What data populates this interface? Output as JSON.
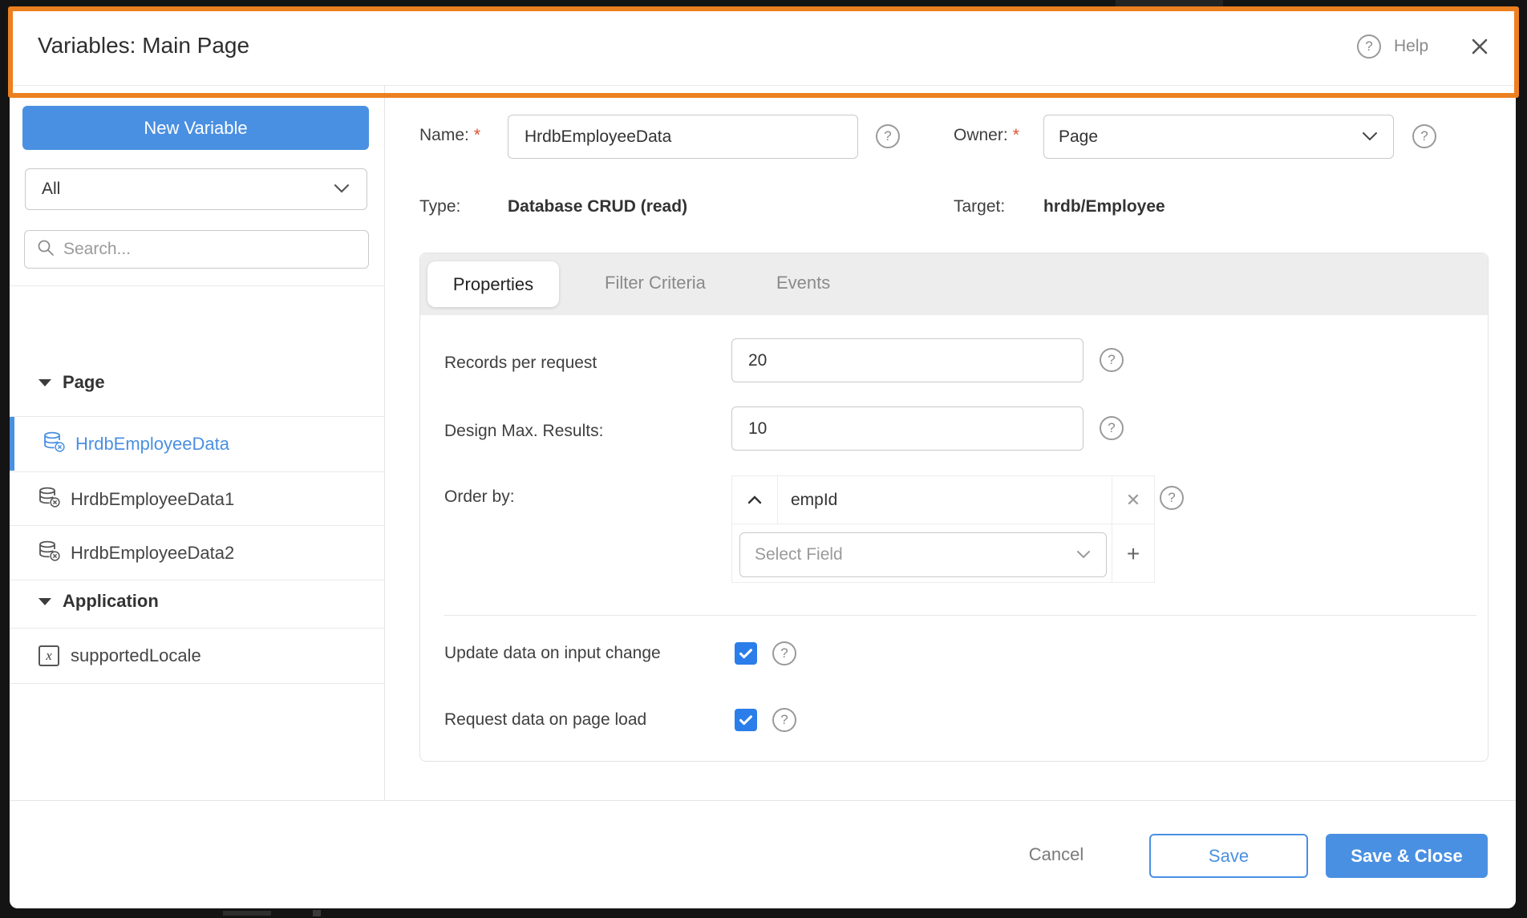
{
  "header": {
    "title": "Variables: Main Page",
    "help_label": "Help"
  },
  "sidebar": {
    "new_variable_label": "New Variable",
    "filter_value": "All",
    "search_placeholder": "Search...",
    "sections": [
      {
        "label": "Page",
        "items": [
          {
            "name": "HrdbEmployeeData"
          },
          {
            "name": "HrdbEmployeeData1"
          },
          {
            "name": "HrdbEmployeeData2"
          }
        ]
      },
      {
        "label": "Application",
        "items": [
          {
            "name": "supportedLocale"
          }
        ]
      }
    ]
  },
  "form": {
    "name": {
      "label": "Name:",
      "asterisk": "*",
      "value": "HrdbEmployeeData"
    },
    "owner": {
      "label": "Owner:",
      "asterisk": "*",
      "value": "Page"
    },
    "type": {
      "label": "Type:",
      "value": "Database CRUD (read)"
    },
    "target": {
      "label": "Target:",
      "value": "hrdb/Employee"
    }
  },
  "tabs": [
    {
      "label": "Properties",
      "active": true
    },
    {
      "label": "Filter Criteria",
      "active": false
    },
    {
      "label": "Events",
      "active": false
    }
  ],
  "properties": {
    "records_per_request": {
      "label": "Records per request",
      "value": "20"
    },
    "design_max_results": {
      "label": "Design Max. Results:",
      "value": "10"
    },
    "order_by": {
      "label": "Order by:",
      "field": "empId",
      "select_placeholder": "Select Field"
    },
    "update_on_input": {
      "label": "Update data on input change",
      "checked": true
    },
    "request_on_load": {
      "label": "Request data on page load",
      "checked": true
    }
  },
  "footer": {
    "cancel_label": "Cancel",
    "save_label": "Save",
    "save_close_label": "Save & Close"
  },
  "icons": {
    "help_glyph": "?",
    "remove_glyph": "✕",
    "add_glyph": "+",
    "model_glyph": "x"
  },
  "colors": {
    "accent_blue": "#4a90e2",
    "checkbox_blue": "#2b7de9",
    "highlight_orange": "#ec8020"
  }
}
